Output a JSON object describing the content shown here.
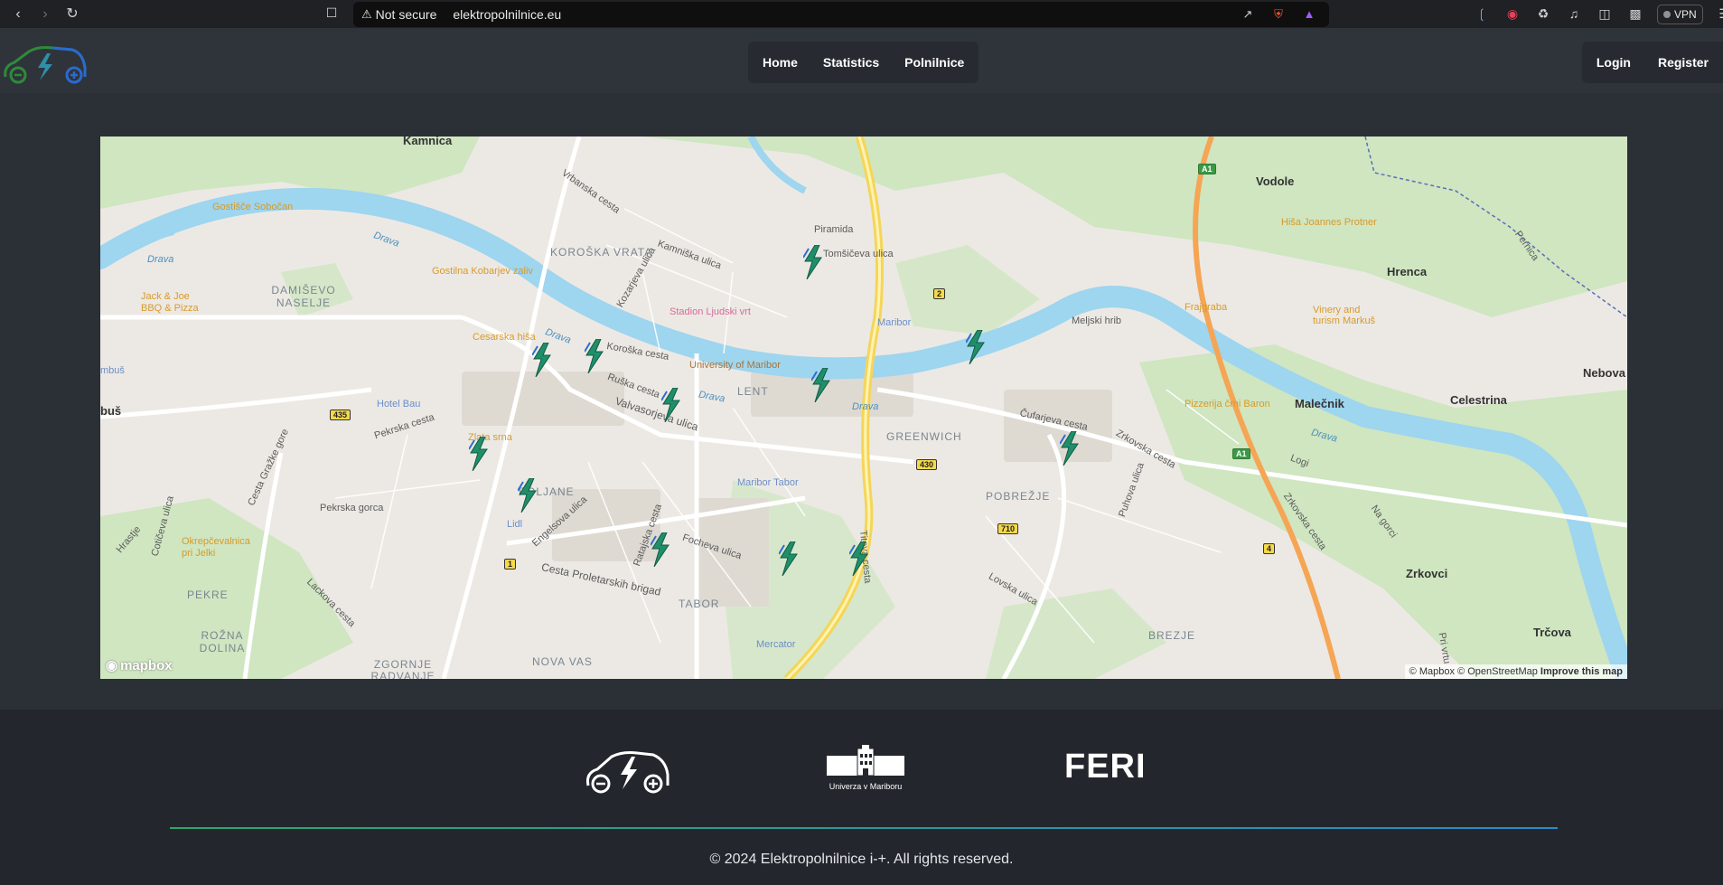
{
  "browser": {
    "security_label": "Not secure",
    "url": "elektropolnilnice.eu",
    "vpn_label": "VPN",
    "icons": [
      "back-icon",
      "forward-icon",
      "reload-icon",
      "bookmark-icon",
      "share-icon",
      "brave-shield-icon",
      "bat-rewards-icon",
      "ai-icon",
      "record-icon",
      "extensions-icon",
      "media-icon",
      "sidebar-icon",
      "wallet-icon",
      "menu-icon"
    ]
  },
  "header": {
    "nav": {
      "home": "Home",
      "statistics": "Statistics",
      "polnilnice": "Polnilnice"
    },
    "auth": {
      "login": "Login",
      "register": "Register"
    }
  },
  "map": {
    "labels": {
      "kamnica": "Kamnica",
      "vrbanska": "Vrbanska cesta",
      "kamniska": "Kamniška ulica",
      "piramida": "Piramida",
      "tomsiceva": "Tomšičeva ulica",
      "vodole": "Vodole",
      "hisa_joannes": "Hiša Joannes Protner",
      "hrenca": "Hrenca",
      "pernica": "Pernica",
      "gostisce_sobocan": "Gostišče Sobočan",
      "drava1": "Drava",
      "drava2": "Drava",
      "drava3": "Drava",
      "drava4": "Drava",
      "drava5": "Drava",
      "drava6": "Drava",
      "koroska_vrata": "KOROŠKA VRATA",
      "kozarjeva": "Kozarjeva ulica",
      "stadion": "Stadion Ljudski vrt",
      "maribor": "Maribor",
      "meljski_hrib": "Meljski hrib",
      "frajgraba": "Frajgraba",
      "vinery": "Vinery and turism Markuš",
      "damisevo": "DAMIŠEVO NASELJE",
      "gostilna_kobarjev": "Gostilna Kobarjev zaliv",
      "jack_joe": "Jack & Joe BBQ & Pizza",
      "koroska_cesta": "Koroška cesta",
      "cesarska": "Cesarska hiša",
      "uni_maribor": "University of Maribor",
      "nebova": "Nebova",
      "lent": "LENT",
      "ruska": "Ruška cesta",
      "hotel_bau": "Hotel Bau",
      "valvasorjeva": "Valvasorjeva ulica",
      "greenwich": "GREENWICH",
      "cufarjeva": "Čufarjeva cesta",
      "pizzerija": "Pizzerija črni Baron",
      "malecnik": "Malečnik",
      "celestrina": "Celestrina",
      "pekrska": "Pekrska cesta",
      "zlata_srna": "Zlata srna",
      "cesta_grasko": "Cesta Gražke gore",
      "zrkovska": "Zrkovska cesta",
      "logi": "Logi",
      "poljane": "POLJANE",
      "maribor_tabor": "Maribor Tabor",
      "pobrezje": "POBREŽJE",
      "pekrska_gorca": "Pekrska gorca",
      "lidl": "Lidl",
      "engelsova": "Engelsova ulica",
      "titova": "Titova cesta",
      "puhova": "Puhova ulica",
      "zrkovska2": "Zrkovska cesta",
      "na_gorci": "Na gorci",
      "hrastje": "Hrastje",
      "cotceva": "Cotičeva ulica",
      "okrepcevalnica": "Okrepčevalnica pri Jelki",
      "ratajska": "Ratajska cesta",
      "focheva": "Focheva ulica",
      "proletarskih": "Cesta Proletarskih brigad",
      "zrkovci": "Zrkovci",
      "pekre": "PEKRE",
      "tabor": "TABOR",
      "lovska": "Lovska ulica",
      "lackova": "Lackova cesta",
      "rozna_dolina": "ROŽNA DOLINA",
      "mercator": "Mercator",
      "brezje": "BREZJE",
      "trcova": "Trčova",
      "zgornje": "ZGORNJE RADVANJE",
      "nova_vas": "NOVA VAS",
      "buz": "buš",
      "mbus": "mbuš",
      "sharova": "Pri vrtu"
    },
    "shields": {
      "a1a": "A1",
      "a1b": "A1",
      "r2": "2",
      "r430": "430",
      "r435": "435",
      "r710": "710",
      "r1": "1",
      "r4": "4"
    },
    "attribution": {
      "mapbox": "© Mapbox",
      "osm": "© OpenStreetMap",
      "improve": "Improve this map"
    },
    "mapbox_logo": "mapbox",
    "marker_color": "#1f8f6a",
    "water_color": "#9ed5ef",
    "park_color": "#cfe6c1"
  },
  "footer": {
    "university_label": "Univerza v Mariboru",
    "feri_label": "FERI",
    "copyright": "© 2024 Elektropolnilnice i-+. All rights reserved."
  }
}
